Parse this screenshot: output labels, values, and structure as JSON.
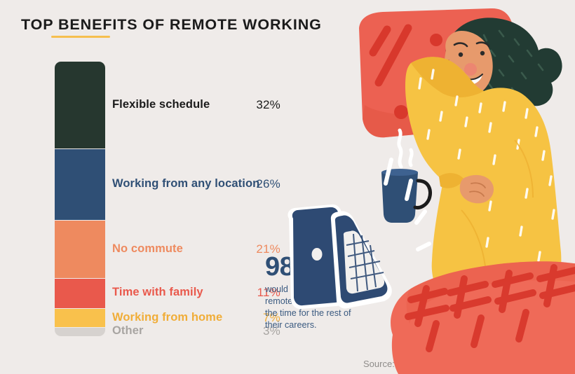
{
  "header": {
    "title": "TOP BENEFITS OF REMOTE WORKING",
    "underline_color": "#f6bf4f"
  },
  "chart_data": {
    "type": "bar",
    "title": "TOP BENEFITS OF REMOTE WORKING",
    "orientation": "vertical-stacked",
    "xlabel": "",
    "ylabel": "",
    "unit": "%",
    "total": 100,
    "grid": false,
    "legend_position": "inline-right",
    "categories": [
      "Flexible schedule",
      "Working from any location",
      "No commute",
      "Time with family",
      "Working from home",
      "Other"
    ],
    "values": [
      32,
      26,
      21,
      11,
      7,
      3
    ],
    "value_labels": [
      "32%",
      "26%",
      "21%",
      "11%",
      "7%",
      "3%"
    ],
    "colors": [
      "#26372f",
      "#2f4f75",
      "#ee8a5f",
      "#e9594c",
      "#f9c14c",
      "#d6d2cf"
    ],
    "label_colors": [
      "#1b1b1b",
      "#2f4f75",
      "#ee8a5f",
      "#e9594c",
      "#f0ad38",
      "#a8a5a2"
    ],
    "segments": [
      {
        "label": "Flexible schedule",
        "value": 32,
        "value_label": "32%",
        "color": "#26372f",
        "text_color": "#1b1b1b"
      },
      {
        "label": "Working from any location",
        "value": 26,
        "value_label": "26%",
        "color": "#2f4f75",
        "text_color": "#2f4f75"
      },
      {
        "label": "No commute",
        "value": 21,
        "value_label": "21%",
        "color": "#ee8a5f",
        "text_color": "#ee8a5f"
      },
      {
        "label": "Time with family",
        "value": 11,
        "value_label": "11%",
        "color": "#e9594c",
        "text_color": "#e9594c"
      },
      {
        "label": "Working from home",
        "value": 7,
        "value_label": "7%",
        "color": "#f9c14c",
        "text_color": "#f0ad38"
      },
      {
        "label": "Other",
        "value": 3,
        "value_label": "3%",
        "color": "#d6d2cf",
        "text_color": "#a8a5a2"
      }
    ]
  },
  "stat": {
    "number": "98%",
    "description": "would like to work remotely at least some of the time for the rest of their careers.",
    "color": "#2f4f75"
  },
  "footer": {
    "source": "Source: Buffer – State of Remote Report",
    "logo_name": "binoculars-logo"
  },
  "illustration": {
    "name": "woman-lying-with-laptop-and-mug",
    "pillow_color": "#ec6152",
    "blanket_color": "#ef6a58",
    "pajama_color": "#f6c343",
    "hair_color": "#223b33",
    "laptop_color": "#2e4a73",
    "mug_color": "#2f4f75",
    "skin_color": "#e79a6c"
  }
}
